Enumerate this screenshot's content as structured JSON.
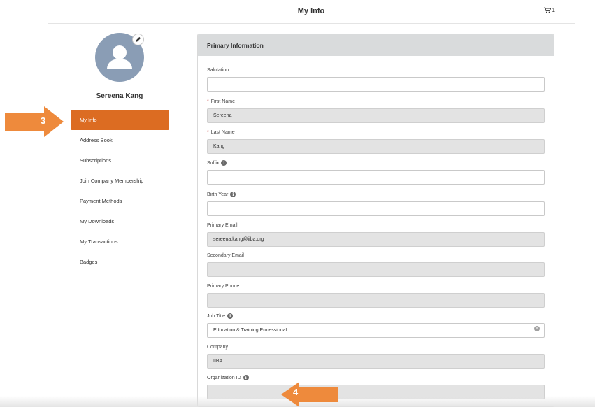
{
  "header": {
    "title": "My Info",
    "cart_count": "1",
    "cart_icon": "cart-icon"
  },
  "profile": {
    "name": "Sereena Kang",
    "avatar_icon": "user-avatar-icon",
    "edit_icon": "pencil-icon"
  },
  "sidebar": {
    "items": [
      {
        "label": "My Info",
        "active": true
      },
      {
        "label": "Address Book",
        "active": false
      },
      {
        "label": "Subscriptions",
        "active": false
      },
      {
        "label": "Join Company Membership",
        "active": false
      },
      {
        "label": "Payment Methods",
        "active": false
      },
      {
        "label": "My Downloads",
        "active": false
      },
      {
        "label": "My Transactions",
        "active": false
      },
      {
        "label": "Badges",
        "active": false
      }
    ]
  },
  "callouts": {
    "step3": "3",
    "step4": "4",
    "color": "#ee8a3c"
  },
  "form": {
    "section_title": "Primary Information",
    "fields": {
      "salutation": {
        "label": "Salutation",
        "value": ""
      },
      "first_name": {
        "label": "First Name",
        "value": "Sereena",
        "required": true
      },
      "last_name": {
        "label": "Last Name",
        "value": "Kang",
        "required": true
      },
      "suffix": {
        "label": "Suffix",
        "value": ""
      },
      "birth_year": {
        "label": "Birth Year",
        "value": ""
      },
      "primary_email": {
        "label": "Primary Email",
        "value": "sereena.kang@iiba.org"
      },
      "secondary_email": {
        "label": "Secondary Email",
        "value": ""
      },
      "primary_phone": {
        "label": "Primary Phone",
        "value": ""
      },
      "job_title": {
        "label": "Job Title",
        "value": "Education & Training Professional"
      },
      "company": {
        "label": "Company",
        "value": "IIBA"
      },
      "organization_id": {
        "label": "Organization ID",
        "value": ""
      }
    }
  },
  "colors": {
    "accent": "#dc6c22",
    "readonly_bg": "#e3e3e3",
    "header_bg": "#d9dbdc"
  }
}
